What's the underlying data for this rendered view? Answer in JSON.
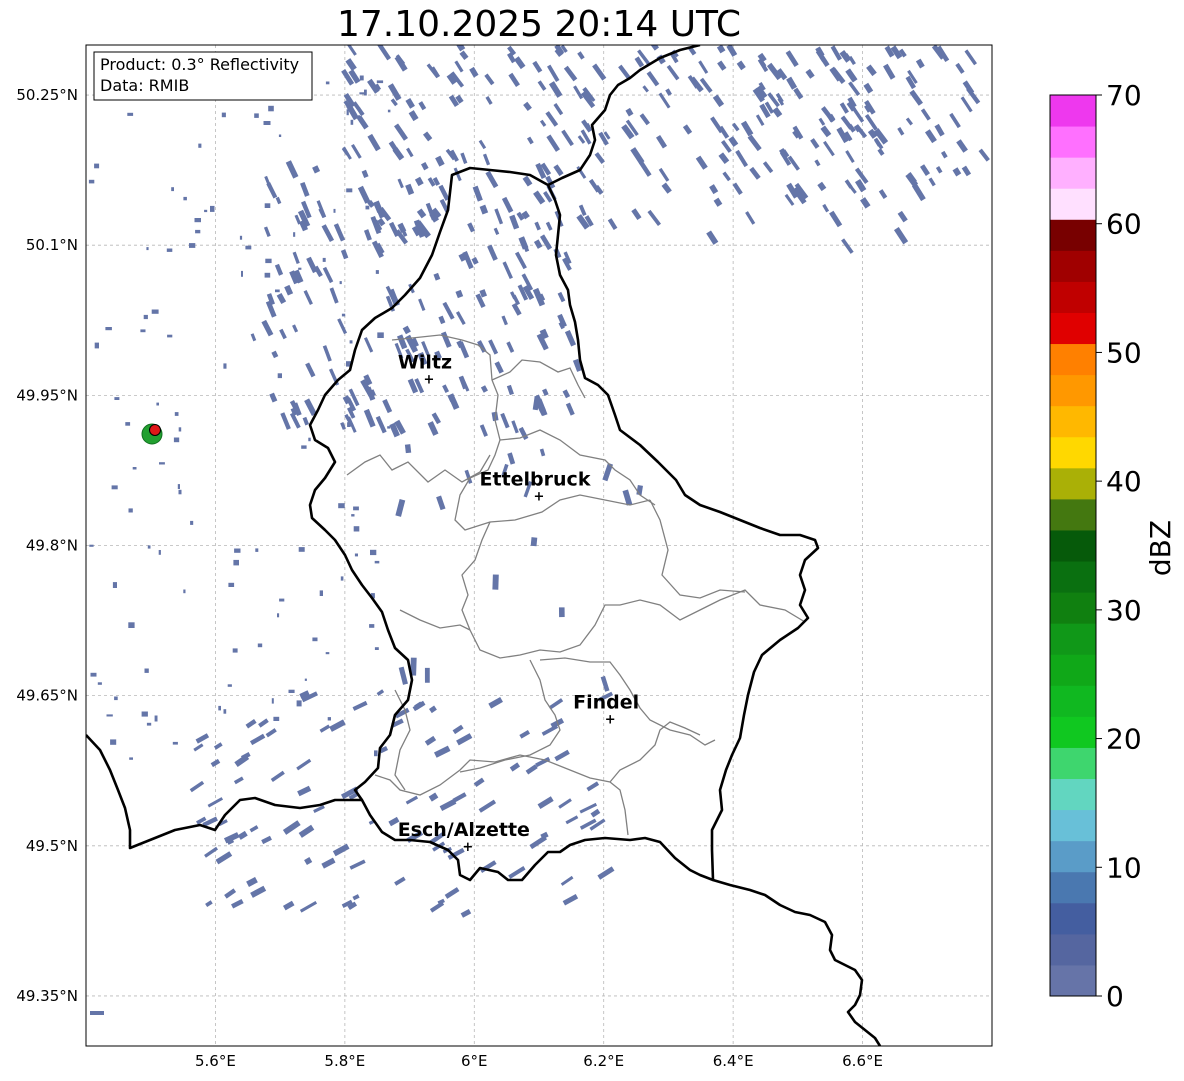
{
  "title": "17.10.2025 20:14 UTC",
  "info": {
    "product": "Product: 0.3° Reflectivity",
    "data": "Data: RMIB"
  },
  "map": {
    "lon_range": [
      5.4,
      6.8
    ],
    "lat_range": [
      49.3,
      50.3
    ],
    "lon_ticks": [
      5.6,
      5.8,
      6.0,
      6.2,
      6.4,
      6.6
    ],
    "lon_tick_labels": [
      "5.6°E",
      "5.8°E",
      "6°E",
      "6.2°E",
      "6.4°E",
      "6.6°E"
    ],
    "lat_ticks": [
      50.25,
      50.1,
      49.95,
      49.8,
      49.65,
      49.5,
      49.35
    ],
    "lat_tick_labels": [
      "50.25°N",
      "50.1°N",
      "49.95°N",
      "49.8°N",
      "49.65°N",
      "49.5°N",
      "49.35°N"
    ],
    "grid": true,
    "cities": [
      {
        "name": "Wiltz",
        "lon": 5.93,
        "lat": 49.967
      },
      {
        "name": "Ettelbruck",
        "lon": 6.1,
        "lat": 49.85
      },
      {
        "name": "Findel",
        "lon": 6.21,
        "lat": 49.627
      },
      {
        "name": "Esch/Alzette",
        "lon": 5.99,
        "lat": 49.5
      }
    ],
    "radar_site": {
      "lon": 5.505,
      "lat": 49.914
    }
  },
  "colorbar": {
    "label": "dBZ",
    "ticks": [
      "0",
      "10",
      "20",
      "30",
      "40",
      "50",
      "60",
      "70"
    ],
    "min": 0,
    "max": 70,
    "colors": [
      "#6674a8",
      "#5566a0",
      "#445ea0",
      "#4a78b0",
      "#5a9cc8",
      "#68c0d8",
      "#62d6c0",
      "#3ed66e",
      "#10c820",
      "#10b820",
      "#10a818",
      "#109818",
      "#108010",
      "#0a7010",
      "#065a0a",
      "#447810",
      "#aab006",
      "#ffd800",
      "#ffb800",
      "#ff9800",
      "#ff8000",
      "#e00000",
      "#c00000",
      "#a00000",
      "#780000",
      "#ffe0ff",
      "#ffb0ff",
      "#ff70ff",
      "#ee38ee"
    ]
  },
  "colors": {
    "echo": "#6475a8",
    "border": "#000000",
    "canton": "#808080",
    "radar_ring": "#22a030",
    "radar_center": "#e01818"
  }
}
